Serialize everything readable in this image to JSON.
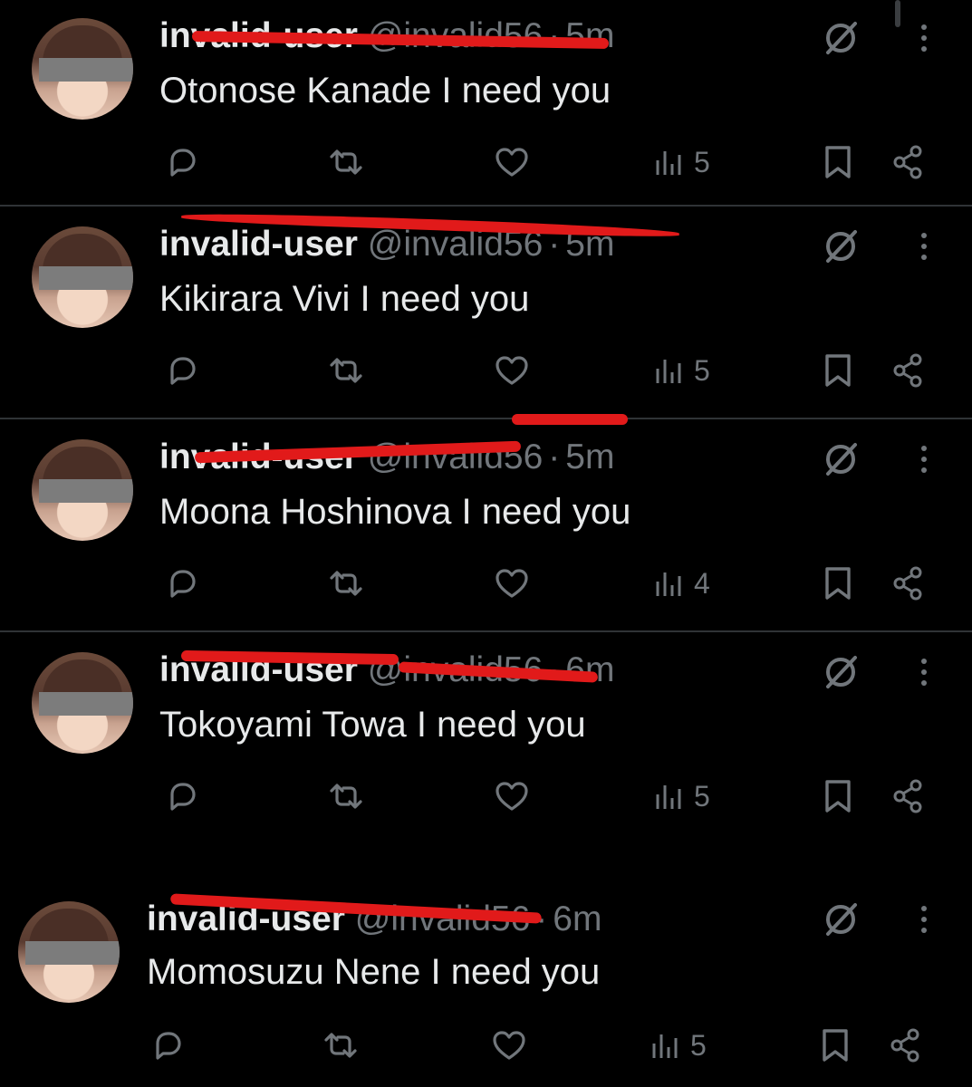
{
  "colors": {
    "background": "#000000",
    "divider": "#2f3336",
    "text_primary": "#e7e9ea",
    "text_secondary": "#71767b",
    "redaction": "#e11a1a",
    "censor_bar": "#7c7c7c"
  },
  "tweets": [
    {
      "display_name": "invalid-user",
      "handle": "@invalid56",
      "dot": "·",
      "time": "5m",
      "text": "Otonose Kanade I need you",
      "views": "5",
      "icons": [
        "grok-icon",
        "more-icon",
        "reply-icon",
        "retweet-icon",
        "like-icon",
        "views-icon",
        "bookmark-icon",
        "share-icon"
      ]
    },
    {
      "display_name": "invalid-user",
      "handle": "@invalid56",
      "dot": "·",
      "time": "5m",
      "text": "Kikirara Vivi I need you",
      "views": "5",
      "icons": [
        "grok-icon",
        "more-icon",
        "reply-icon",
        "retweet-icon",
        "like-icon",
        "views-icon",
        "bookmark-icon",
        "share-icon"
      ]
    },
    {
      "display_name": "invalid-user",
      "handle": "@invalid56",
      "dot": "·",
      "time": "5m",
      "text": "Moona Hoshinova I need you",
      "views": "4",
      "icons": [
        "grok-icon",
        "more-icon",
        "reply-icon",
        "retweet-icon",
        "like-icon",
        "views-icon",
        "bookmark-icon",
        "share-icon"
      ]
    },
    {
      "display_name": "invalid-user",
      "handle": "@invalid56",
      "dot": "·",
      "time": "6m",
      "text": "Tokoyami Towa I need you",
      "views": "5",
      "icons": [
        "grok-icon",
        "more-icon",
        "reply-icon",
        "retweet-icon",
        "like-icon",
        "views-icon",
        "bookmark-icon",
        "share-icon"
      ]
    },
    {
      "display_name": "invalid-user",
      "handle": "@invalid56",
      "dot": "·",
      "time": "6m",
      "text": "Momosuzu Nene I need you",
      "views": "5",
      "icons": [
        "grok-icon",
        "more-icon",
        "reply-icon",
        "retweet-icon",
        "like-icon",
        "views-icon",
        "bookmark-icon",
        "share-icon"
      ]
    }
  ]
}
